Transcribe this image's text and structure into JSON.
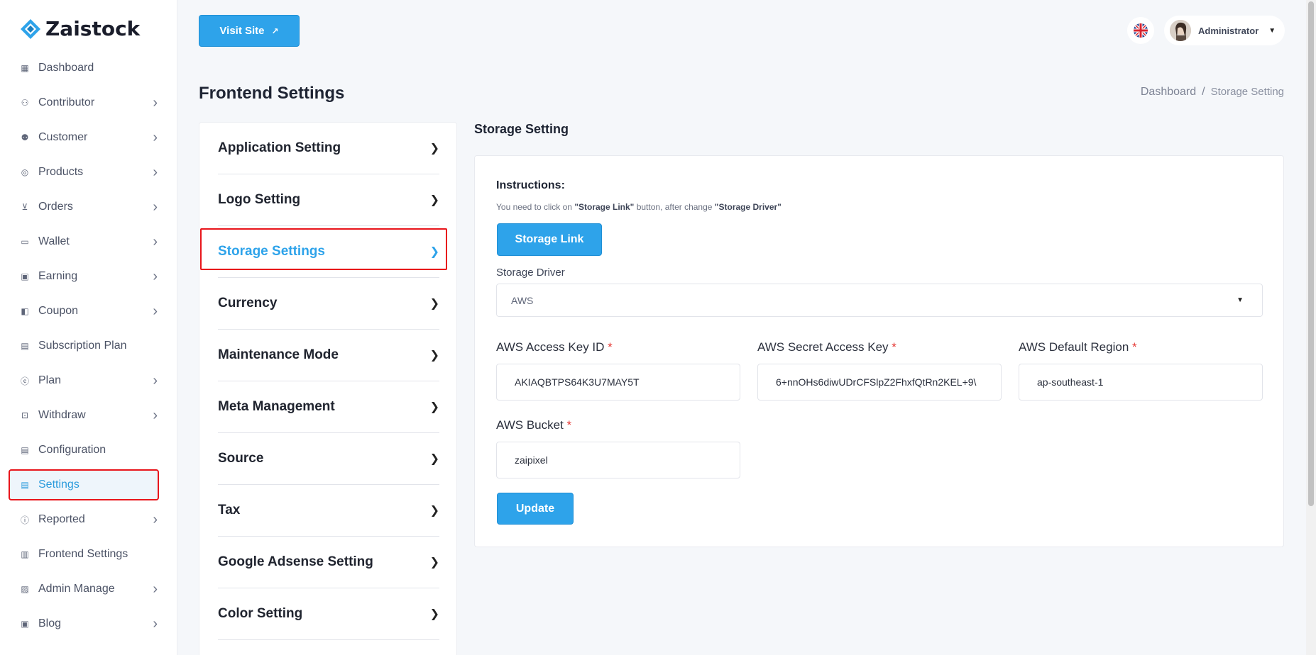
{
  "app": {
    "logo_text": "Zaistock",
    "brand_color": "#2ea3ea"
  },
  "sidebar": {
    "items": [
      {
        "label": "Dashboard",
        "icon": "grid-icon",
        "has_chevron": false
      },
      {
        "label": "Contributor",
        "icon": "user-icon",
        "has_chevron": true
      },
      {
        "label": "Customer",
        "icon": "users-icon",
        "has_chevron": true
      },
      {
        "label": "Products",
        "icon": "product-icon",
        "has_chevron": true
      },
      {
        "label": "Orders",
        "icon": "cart-icon",
        "has_chevron": true
      },
      {
        "label": "Wallet",
        "icon": "wallet-icon",
        "has_chevron": true
      },
      {
        "label": "Earning",
        "icon": "money-icon",
        "has_chevron": true
      },
      {
        "label": "Coupon",
        "icon": "coupon-icon",
        "has_chevron": true
      },
      {
        "label": "Subscription Plan",
        "icon": "subscription-icon",
        "has_chevron": false
      },
      {
        "label": "Plan",
        "icon": "plan-icon",
        "has_chevron": true
      },
      {
        "label": "Withdraw",
        "icon": "withdraw-icon",
        "has_chevron": true
      },
      {
        "label": "Configuration",
        "icon": "config-icon",
        "has_chevron": false
      },
      {
        "label": "Settings",
        "icon": "settings-icon",
        "has_chevron": false,
        "active": true
      },
      {
        "label": "Reported",
        "icon": "report-icon",
        "has_chevron": true
      },
      {
        "label": "Frontend Settings",
        "icon": "frontend-icon",
        "has_chevron": false
      },
      {
        "label": "Admin Manage",
        "icon": "admin-icon",
        "has_chevron": true
      },
      {
        "label": "Blog",
        "icon": "blog-icon",
        "has_chevron": true
      }
    ]
  },
  "topbar": {
    "visit_site_label": "Visit Site",
    "user_name": "Administrator"
  },
  "page": {
    "title": "Frontend Settings",
    "breadcrumb": {
      "home": "Dashboard",
      "separator": "/",
      "current": "Storage Setting"
    }
  },
  "settings_menu": {
    "items": [
      {
        "label": "Application Setting"
      },
      {
        "label": "Logo Setting"
      },
      {
        "label": "Storage Settings",
        "active": true
      },
      {
        "label": "Currency"
      },
      {
        "label": "Maintenance Mode"
      },
      {
        "label": "Meta Management"
      },
      {
        "label": "Source"
      },
      {
        "label": "Tax"
      },
      {
        "label": "Google Adsense Setting"
      },
      {
        "label": "Color Setting"
      }
    ]
  },
  "storage": {
    "section_title": "Storage Setting",
    "instructions_title": "Instructions:",
    "instructions_pre": "You need to click on ",
    "instructions_link": "\"Storage Link\"",
    "instructions_mid": " button, after change ",
    "instructions_driver": "\"Storage Driver\"",
    "storage_link_button": "Storage Link",
    "driver_label": "Storage Driver",
    "driver_value": "AWS",
    "access_key_label": "AWS Access Key ID",
    "access_key_value": "AKIAQBTPS64K3U7MAY5T",
    "secret_key_label": "AWS Secret Access Key",
    "secret_key_value": "6+nnOHs6diwUDrCFSlpZ2FhxfQtRn2KEL+9\\",
    "region_label": "AWS Default Region",
    "region_value": "ap-southeast-1",
    "bucket_label": "AWS Bucket",
    "bucket_value": "zaipixel",
    "required_mark": "*",
    "update_button": "Update"
  }
}
